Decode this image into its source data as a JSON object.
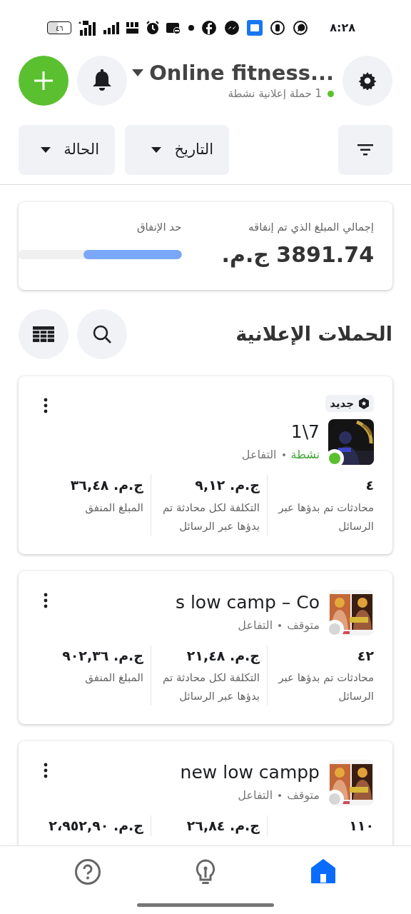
{
  "status_bar": {
    "time": "٨:٢٨",
    "battery": "٤٦"
  },
  "header": {
    "title": "Online fitness...",
    "subtitle": "1 حملة إعلانية نشطة",
    "active": true
  },
  "filters": [
    {
      "label": "التاريخ"
    },
    {
      "label": "الحالة"
    }
  ],
  "summary": {
    "spent_label": "إجمالي المبلغ الذي تم إنفاقه",
    "spent_value": "3891.74 ج.م.",
    "limit_label": "حد الإنفاق",
    "level": 0.6
  },
  "section_title": "الحملات الإعلانية",
  "campaigns": [
    {
      "badge": "جديد",
      "name": "1\\7",
      "status": "نشطة",
      "active": true,
      "objective": "التفاعل",
      "stats": [
        {
          "value": "٤",
          "label": "محادثات تم بدؤها عبر الرسائل"
        },
        {
          "value": "ج.م. ٩,١٢",
          "label": "التكلفة لكل محادثة تم بدؤها عبر الرسائل"
        },
        {
          "value": "ج.م. ٣٦,٤٨",
          "label": "المبلغ المنفق"
        }
      ]
    },
    {
      "name": "s low camp – Co",
      "status": "متوقف",
      "active": false,
      "objective": "التفاعل",
      "stats": [
        {
          "value": "٤٢",
          "label": "محادثات تم بدؤها عبر الرسائل"
        },
        {
          "value": "ج.م. ٢١,٤٨",
          "label": "التكلفة لكل محادثة تم بدؤها عبر الرسائل"
        },
        {
          "value": "ج.م. ٩٠٢,٣٦",
          "label": "المبلغ المنفق"
        }
      ]
    },
    {
      "name": "new low campp",
      "status": "متوقف",
      "active": false,
      "objective": "التفاعل",
      "stats": [
        {
          "value": "١١٠"
        },
        {
          "value": "ج.م. ٢٦,٨٤"
        },
        {
          "value": "ج.م. ٢،٩٥٢,٩٠"
        }
      ]
    }
  ],
  "nav": [
    {
      "kind": "help",
      "selected": false
    },
    {
      "kind": "tips",
      "selected": false
    },
    {
      "kind": "home",
      "selected": true
    }
  ]
}
